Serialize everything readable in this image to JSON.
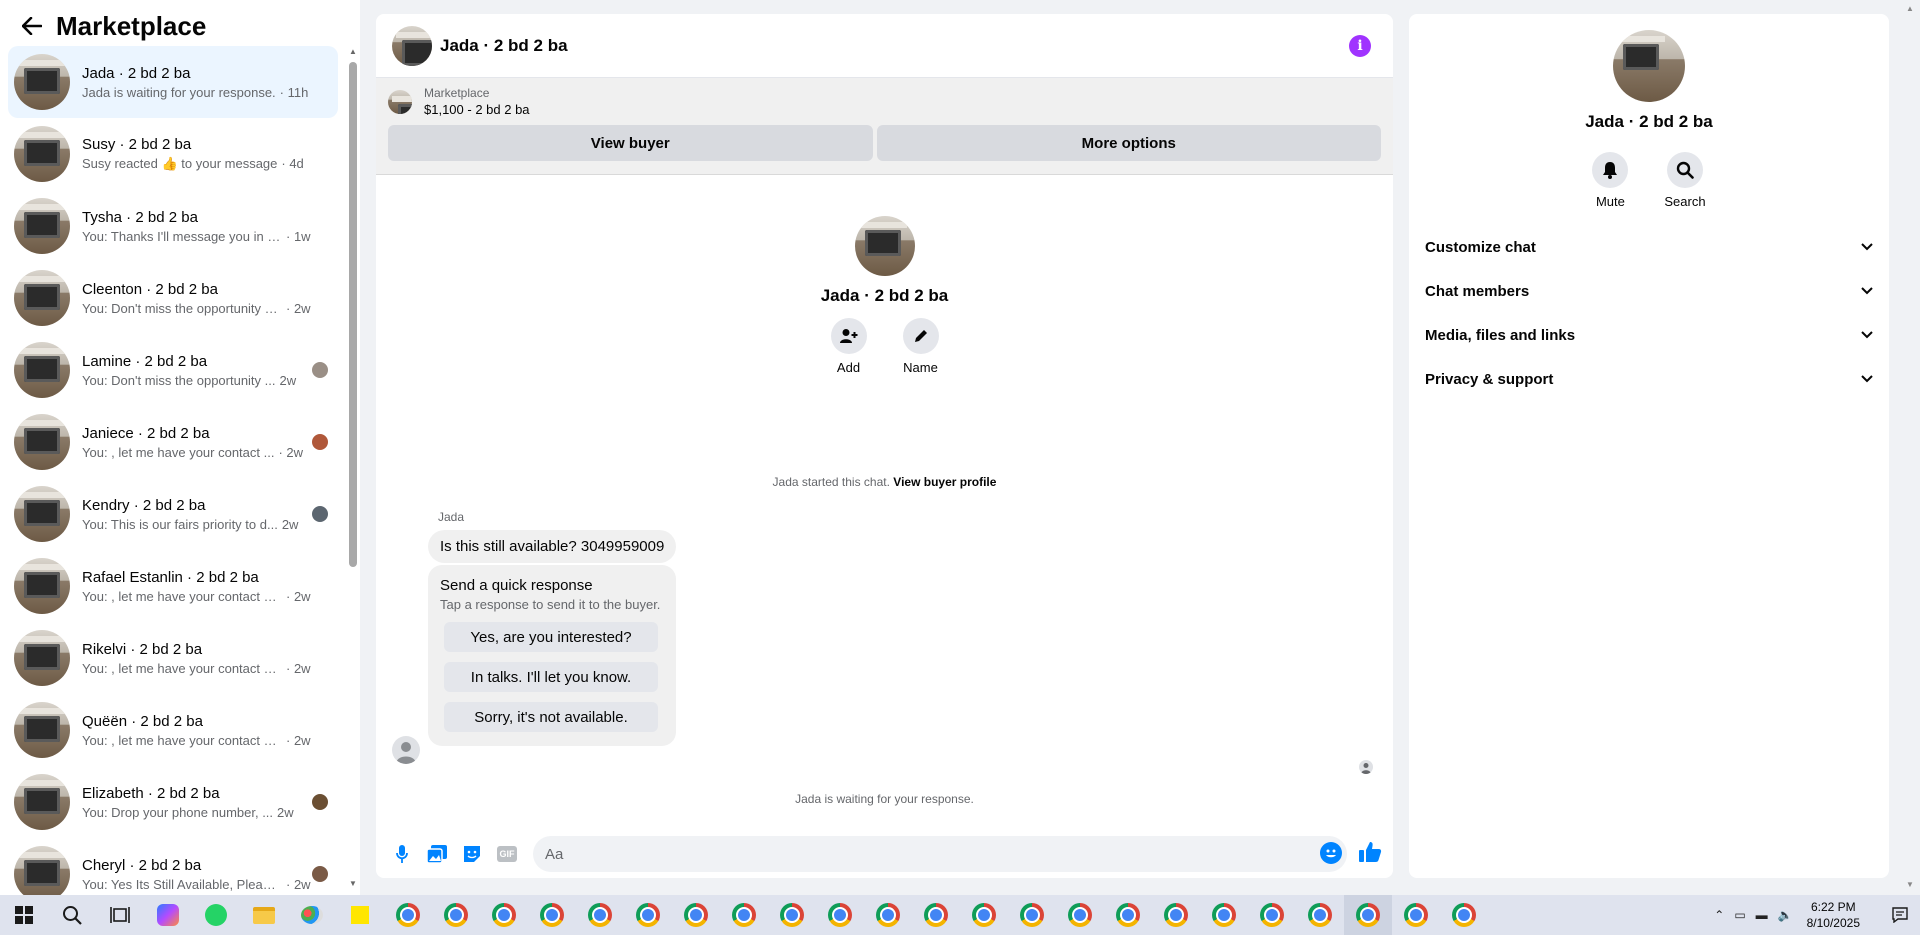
{
  "sidebar": {
    "title": "Marketplace",
    "conversations": [
      {
        "name": "Jada · 2 bd 2 ba",
        "snippet": "Jada is waiting for your response.",
        "time": "· 11h"
      },
      {
        "name": "Susy · 2 bd 2 ba",
        "snippet": "Susy reacted 👍 to your message",
        "time": "· 4d"
      },
      {
        "name": "Tysha · 2 bd 2 ba",
        "snippet": "You: Thanks I'll message you in a ...",
        "time": "· 1w"
      },
      {
        "name": "Cleenton · 2 bd 2 ba",
        "snippet": "You: Don't miss the opportunity an...",
        "time": "· 2w"
      },
      {
        "name": "Lamine · 2 bd 2 ba",
        "snippet": "You: Don't miss the opportunity ...",
        "time": "2w"
      },
      {
        "name": "Janiece · 2 bd 2 ba",
        "snippet": "You: , let me have your contact ...",
        "time": "· 2w"
      },
      {
        "name": "Kendry · 2 bd 2 ba",
        "snippet": "You: This is our fairs priority to d...",
        "time": "2w"
      },
      {
        "name": "Rafael Estanlin · 2 bd 2 ba",
        "snippet": "You: , let me have your contact nu...",
        "time": "· 2w"
      },
      {
        "name": "Rikelvi · 2 bd 2 ba",
        "snippet": "You: , let me have your contact nu...",
        "time": "· 2w"
      },
      {
        "name": "Quëën · 2 bd 2 ba",
        "snippet": "You: , let me have your contact nu...",
        "time": "· 2w"
      },
      {
        "name": "Elizabeth · 2 bd 2 ba",
        "snippet": "You: Drop your phone number, ...",
        "time": "2w"
      },
      {
        "name": "Cheryl · 2 bd 2 ba",
        "snippet": "You: Yes Its Still Available, Please...",
        "time": "· 2w"
      }
    ]
  },
  "chat": {
    "title": "Jada · 2 bd 2 ba",
    "marketplace_label": "Marketplace",
    "listing": "$1,100 - 2 bd 2 ba",
    "view_buyer": "View buyer",
    "more_options": "More options",
    "intro_name": "Jada · 2 bd 2 ba",
    "add_label": "Add",
    "name_label": "Name",
    "started_text": "Jada started this chat.",
    "view_profile": "View buyer profile",
    "sender": "Jada",
    "message": "Is this still available? 3049959009",
    "quick_title": "Send a quick response",
    "quick_sub": "Tap a response to send it to the buyer.",
    "quick_replies": [
      "Yes, are you interested?",
      "In talks. I'll let you know.",
      "Sorry, it's not available."
    ],
    "waiting": "Jada is waiting for your response.",
    "input_placeholder": "Aa",
    "gif_label": "GIF"
  },
  "right_panel": {
    "name": "Jada · 2 bd 2 ba",
    "mute": "Mute",
    "search": "Search",
    "menu": [
      "Customize chat",
      "Chat members",
      "Media, files and links",
      "Privacy & support"
    ]
  },
  "taskbar": {
    "time": "6:22 PM",
    "date": "8/10/2025"
  },
  "colors": {
    "accent": "#0084ff",
    "info": "#a033ff",
    "active_row": "#ebf5ff"
  }
}
